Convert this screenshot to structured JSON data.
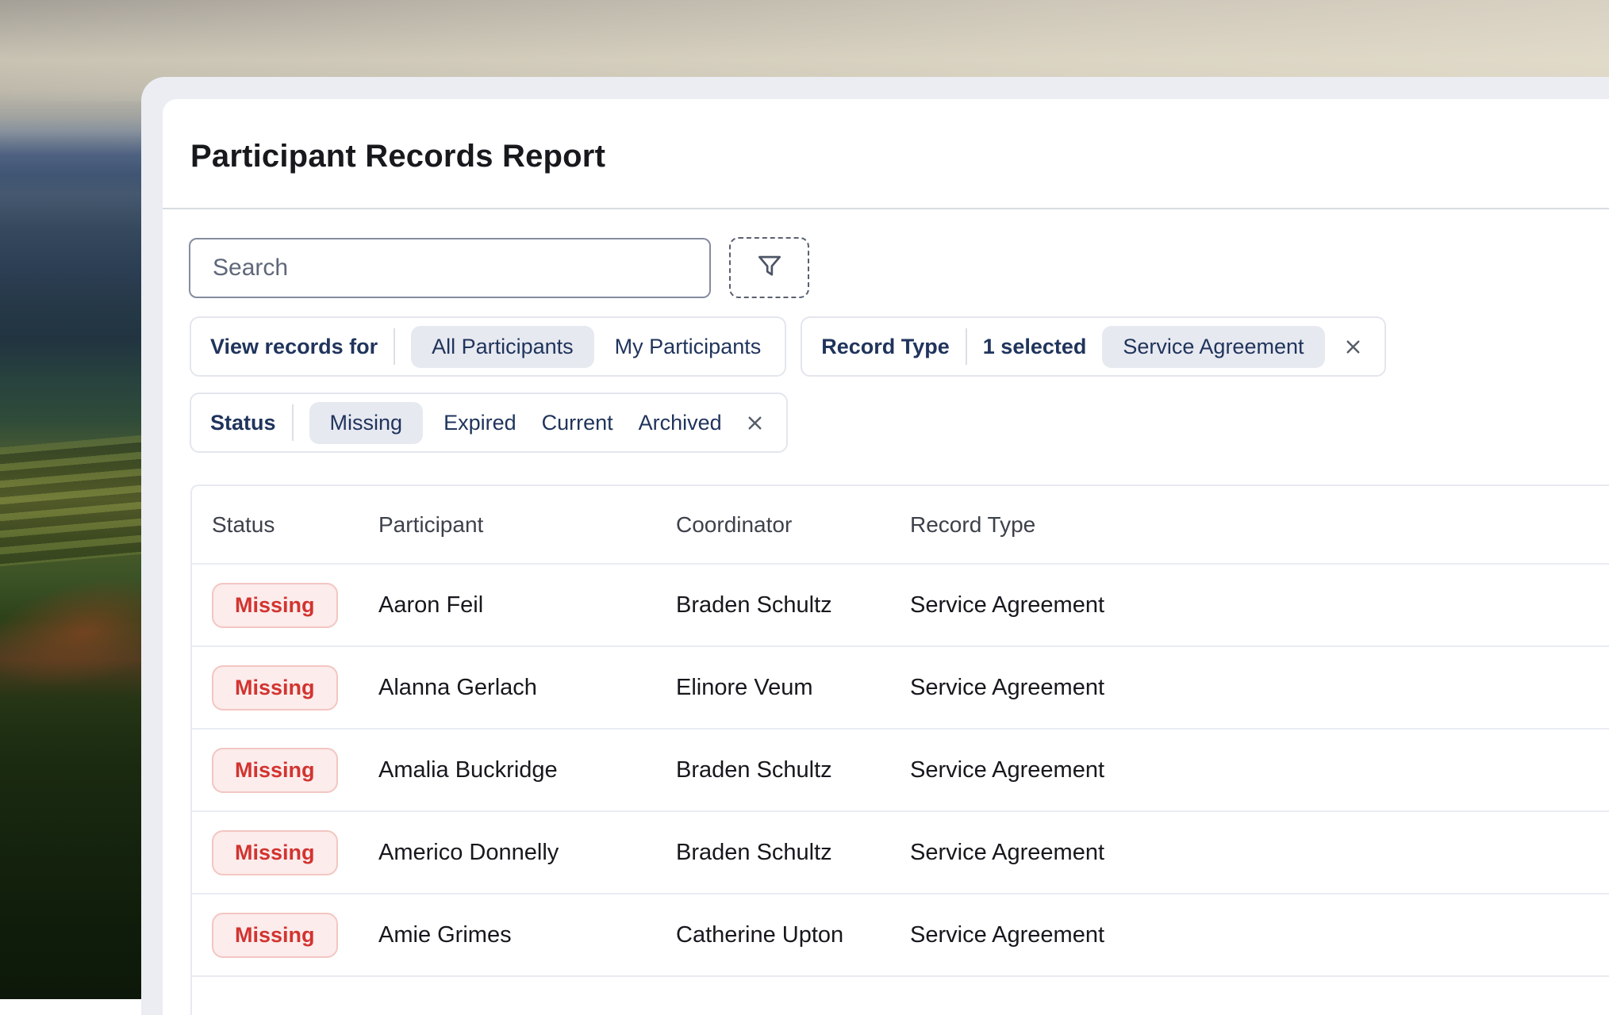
{
  "page_title": "Participant Records Report",
  "search": {
    "placeholder": "Search"
  },
  "toolbar": {
    "filter_button_icon": "funnel-icon"
  },
  "filters": {
    "view_records": {
      "label": "View records for",
      "options": [
        {
          "label": "All Participants",
          "selected": true
        },
        {
          "label": "My Participants",
          "selected": false
        }
      ]
    },
    "record_type": {
      "label": "Record Type",
      "summary": "1 selected",
      "selected_chip": "Service Agreement",
      "dismiss_icon": "close-icon"
    },
    "status": {
      "label": "Status",
      "options": [
        {
          "label": "Missing",
          "selected": true
        },
        {
          "label": "Expired",
          "selected": false
        },
        {
          "label": "Current",
          "selected": false
        },
        {
          "label": "Archived",
          "selected": false
        }
      ],
      "dismiss_icon": "close-icon"
    }
  },
  "table": {
    "columns": [
      "Status",
      "Participant",
      "Coordinator",
      "Record Type"
    ],
    "rows": [
      {
        "status": "Missing",
        "participant": "Aaron Feil",
        "coordinator": "Braden Schultz",
        "record_type": "Service Agreement"
      },
      {
        "status": "Missing",
        "participant": "Alanna Gerlach",
        "coordinator": "Elinore Veum",
        "record_type": "Service Agreement"
      },
      {
        "status": "Missing",
        "participant": "Amalia Buckridge",
        "coordinator": "Braden Schultz",
        "record_type": "Service Agreement"
      },
      {
        "status": "Missing",
        "participant": "Americo Donnelly",
        "coordinator": "Braden Schultz",
        "record_type": "Service Agreement"
      },
      {
        "status": "Missing",
        "participant": "Amie Grimes",
        "coordinator": "Catherine Upton",
        "record_type": "Service Agreement"
      }
    ]
  },
  "colors": {
    "accent_navy": "#20345c",
    "badge_missing_text": "#d23430",
    "badge_missing_bg": "#fcecec",
    "badge_missing_border": "#f3c6c2",
    "selected_pill_bg": "#e7e9f0",
    "frame_bg": "#ebedf2"
  }
}
